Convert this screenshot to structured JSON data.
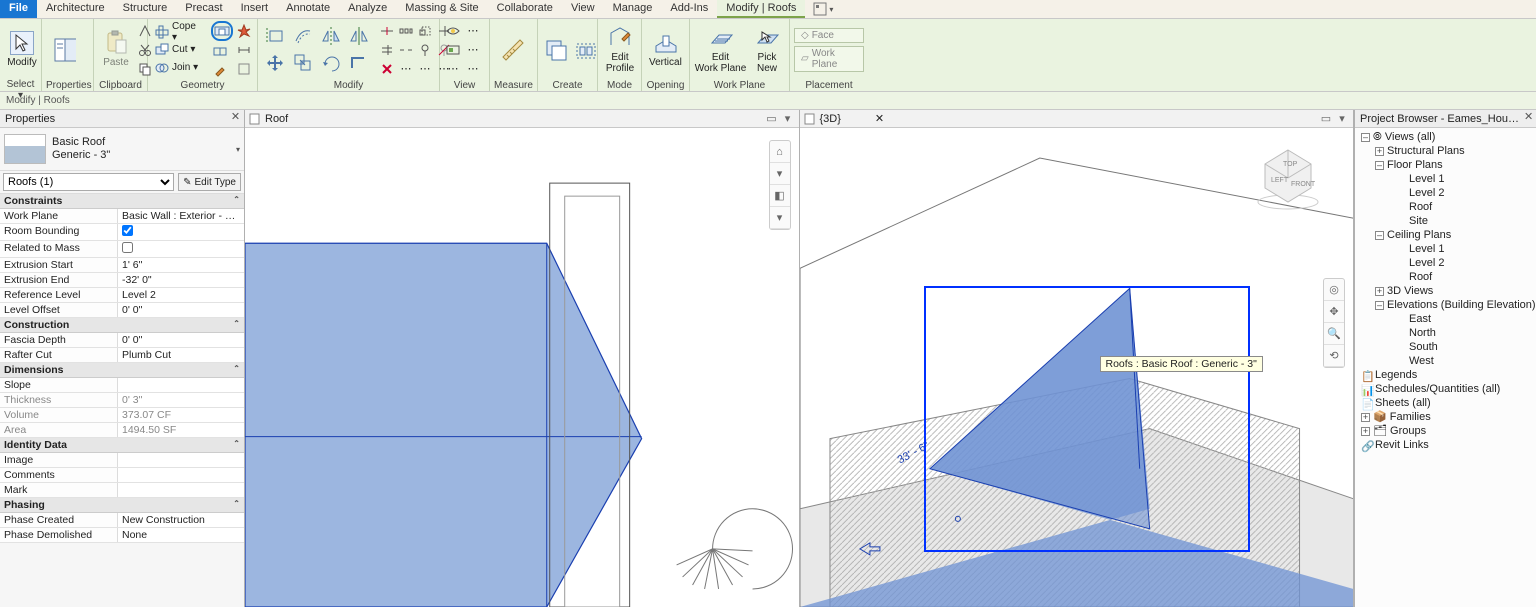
{
  "ribbon": {
    "tabs": [
      "File",
      "Architecture",
      "Structure",
      "Precast",
      "Insert",
      "Annotate",
      "Analyze",
      "Massing & Site",
      "Collaborate",
      "View",
      "Manage",
      "Add-Ins",
      "Modify | Roofs"
    ],
    "active_tab": "Modify | Roofs",
    "panels": {
      "select": "Select ▾",
      "properties": "Properties",
      "clipboard": "Clipboard",
      "geometry": "Geometry",
      "modify": "Modify",
      "view": "View",
      "measure": "Measure",
      "create": "Create",
      "mode": "Mode",
      "opening": "Opening",
      "workplane": "Work Plane",
      "placement": "Placement"
    },
    "btn": {
      "modify": "Modify",
      "paste": "Paste",
      "cope": "Cope ▾",
      "cut": "Cut  ▾",
      "join": "Join  ▾",
      "edit_profile": "Edit\nProfile",
      "vertical": "Vertical",
      "edit_wp": "Edit\nWork Plane",
      "pick_new": "Pick\nNew",
      "face": "Face",
      "wp": "Work Plane"
    }
  },
  "context_label": "Modify | Roofs",
  "properties": {
    "title": "Properties",
    "type_name": "Basic Roof",
    "type_sub": "Generic - 3\"",
    "selector": "Roofs (1)",
    "edit_type": "Edit Type",
    "groups": {
      "constraints": "Constraints",
      "construction": "Construction",
      "dimensions": "Dimensions",
      "identity": "Identity Data",
      "phasing": "Phasing"
    },
    "rows": {
      "work_plane_k": "Work Plane",
      "work_plane_v": "Basic Wall : Exterior - Bri...",
      "room_bounding_k": "Room Bounding",
      "related_k": "Related to Mass",
      "related_v": "",
      "ext_start_k": "Extrusion Start",
      "ext_start_v": "1'  6\"",
      "ext_end_k": "Extrusion End",
      "ext_end_v": "-32'  0\"",
      "ref_level_k": "Reference Level",
      "ref_level_v": "Level 2",
      "lvl_off_k": "Level Offset",
      "lvl_off_v": "0'  0\"",
      "fascia_k": "Fascia Depth",
      "fascia_v": "0'  0\"",
      "rafter_k": "Rafter Cut",
      "rafter_v": "Plumb Cut",
      "slope_k": "Slope",
      "slope_v": "",
      "thick_k": "Thickness",
      "thick_v": "0'  3\"",
      "vol_k": "Volume",
      "vol_v": "373.07 CF",
      "area_k": "Area",
      "area_v": "1494.50 SF",
      "image_k": "Image",
      "image_v": "",
      "comments_k": "Comments",
      "comments_v": "",
      "mark_k": "Mark",
      "mark_v": "",
      "phase_c_k": "Phase Created",
      "phase_c_v": "New Construction",
      "phase_d_k": "Phase Demolished",
      "phase_d_v": "None"
    }
  },
  "view1": {
    "title": "Roof"
  },
  "view2": {
    "title": "{3D}",
    "tooltip": "Roofs : Basic Roof : Generic - 3\"",
    "dim_label": "33' - 6\""
  },
  "project_browser": {
    "title": "Project Browser - Eames_House_Proj...",
    "nodes": {
      "views": "Views (all)",
      "struct": "Structural Plans",
      "floor": "Floor Plans",
      "l1": "Level 1",
      "l2": "Level 2",
      "roof": "Roof",
      "site": "Site",
      "ceil": "Ceiling Plans",
      "c1": "Level 1",
      "c2": "Level 2",
      "croof": "Roof",
      "v3d": "3D Views",
      "elev": "Elevations (Building Elevation)",
      "east": "East",
      "north": "North",
      "south": "South",
      "west": "West",
      "legends": "Legends",
      "sched": "Schedules/Quantities (all)",
      "sheets": "Sheets (all)",
      "families": "Families",
      "groups": "Groups",
      "links": "Revit Links"
    }
  }
}
